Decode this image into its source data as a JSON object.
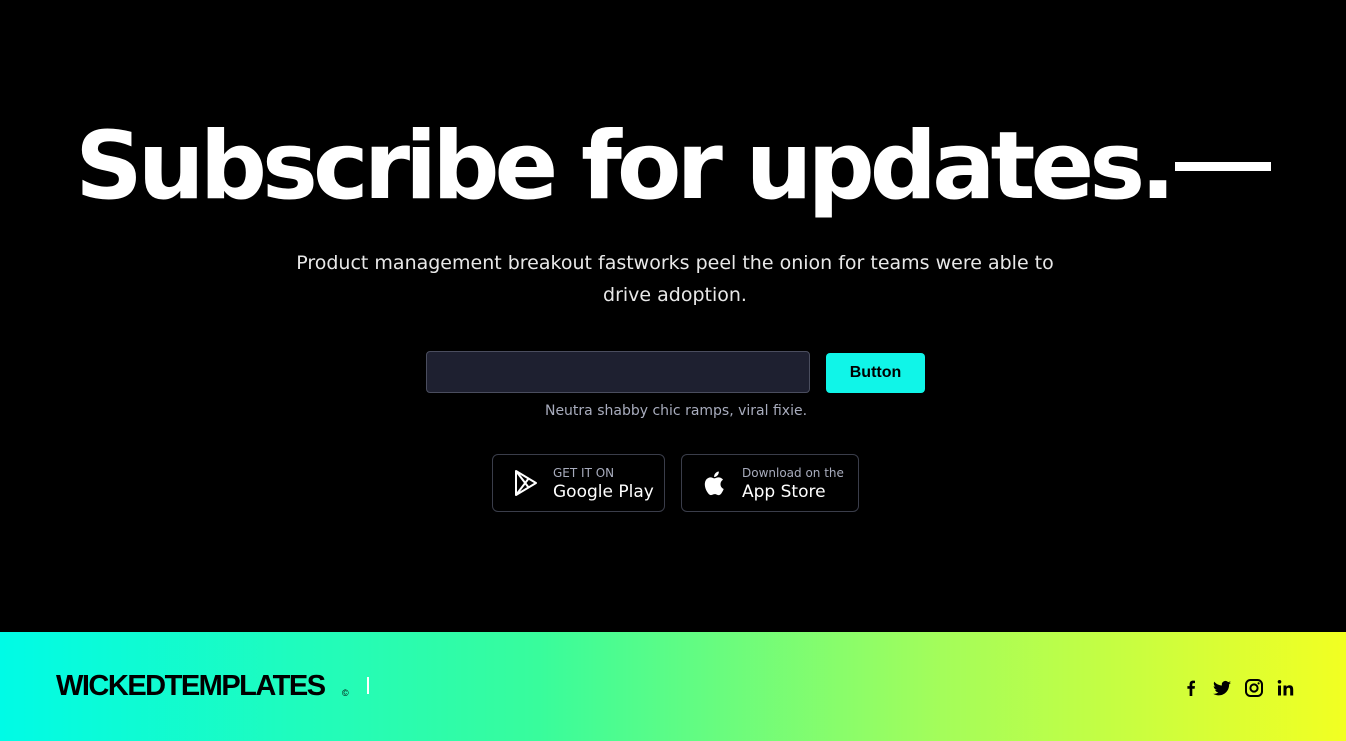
{
  "hero": {
    "headline": "Subscribe for updates.",
    "subtitle": "Product management breakout fastworks peel the onion for teams were able to drive adoption."
  },
  "form": {
    "email_value": "",
    "button_label": "Button",
    "helper_text": "Neutra shabby chic ramps, viral fixie."
  },
  "stores": {
    "google": {
      "small": "GET IT ON",
      "big": "Google Play",
      "icon": "play-store-icon"
    },
    "apple": {
      "small": "Download on the",
      "big": "App Store",
      "icon": "apple-icon"
    }
  },
  "footer": {
    "logo": "WICKEDTEMPLATES",
    "copyright": "©",
    "social": [
      "facebook-icon",
      "twitter-icon",
      "instagram-icon",
      "linkedin-icon"
    ],
    "gradient_start": "#00fbe6",
    "gradient_end": "#f2ff22"
  },
  "colors": {
    "accent": "#10f5e8",
    "background": "#000000"
  }
}
